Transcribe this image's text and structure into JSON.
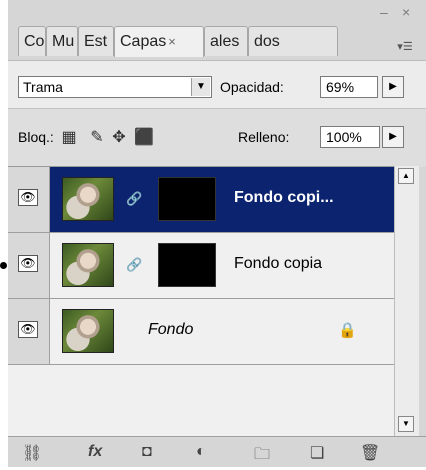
{
  "window_controls": {
    "minimize": "–",
    "close": "×"
  },
  "tabs": [
    {
      "label": "Co"
    },
    {
      "label": "Mu"
    },
    {
      "label": "Est"
    },
    {
      "label": "Capas",
      "active": true,
      "close": "×"
    },
    {
      "label": "ales"
    },
    {
      "label": "dos"
    }
  ],
  "panel_menu_icon": "panel-menu-icon",
  "blend": {
    "mode_value": "Trama",
    "opacity_label": "Opacidad:",
    "opacity_value": "69%"
  },
  "lock": {
    "label": "Bloq.:",
    "fill_label": "Relleno:",
    "fill_value": "100%"
  },
  "layers": [
    {
      "name": "Fondo copi...",
      "selected": true,
      "has_mask": true
    },
    {
      "name": "Fondo copia",
      "selected": false,
      "has_mask": true
    },
    {
      "name": "Fondo",
      "selected": false,
      "italic": true,
      "locked": true
    }
  ],
  "bottom_icons": [
    "link-icon",
    "fx-icon",
    "mask-icon",
    "adjustment-icon",
    "folder-icon",
    "new-layer-icon",
    "trash-icon"
  ],
  "bottom_fx_label": "fx",
  "colors": {
    "selected_row": "#0c2470",
    "panel_bg": "#d6d6d6"
  }
}
